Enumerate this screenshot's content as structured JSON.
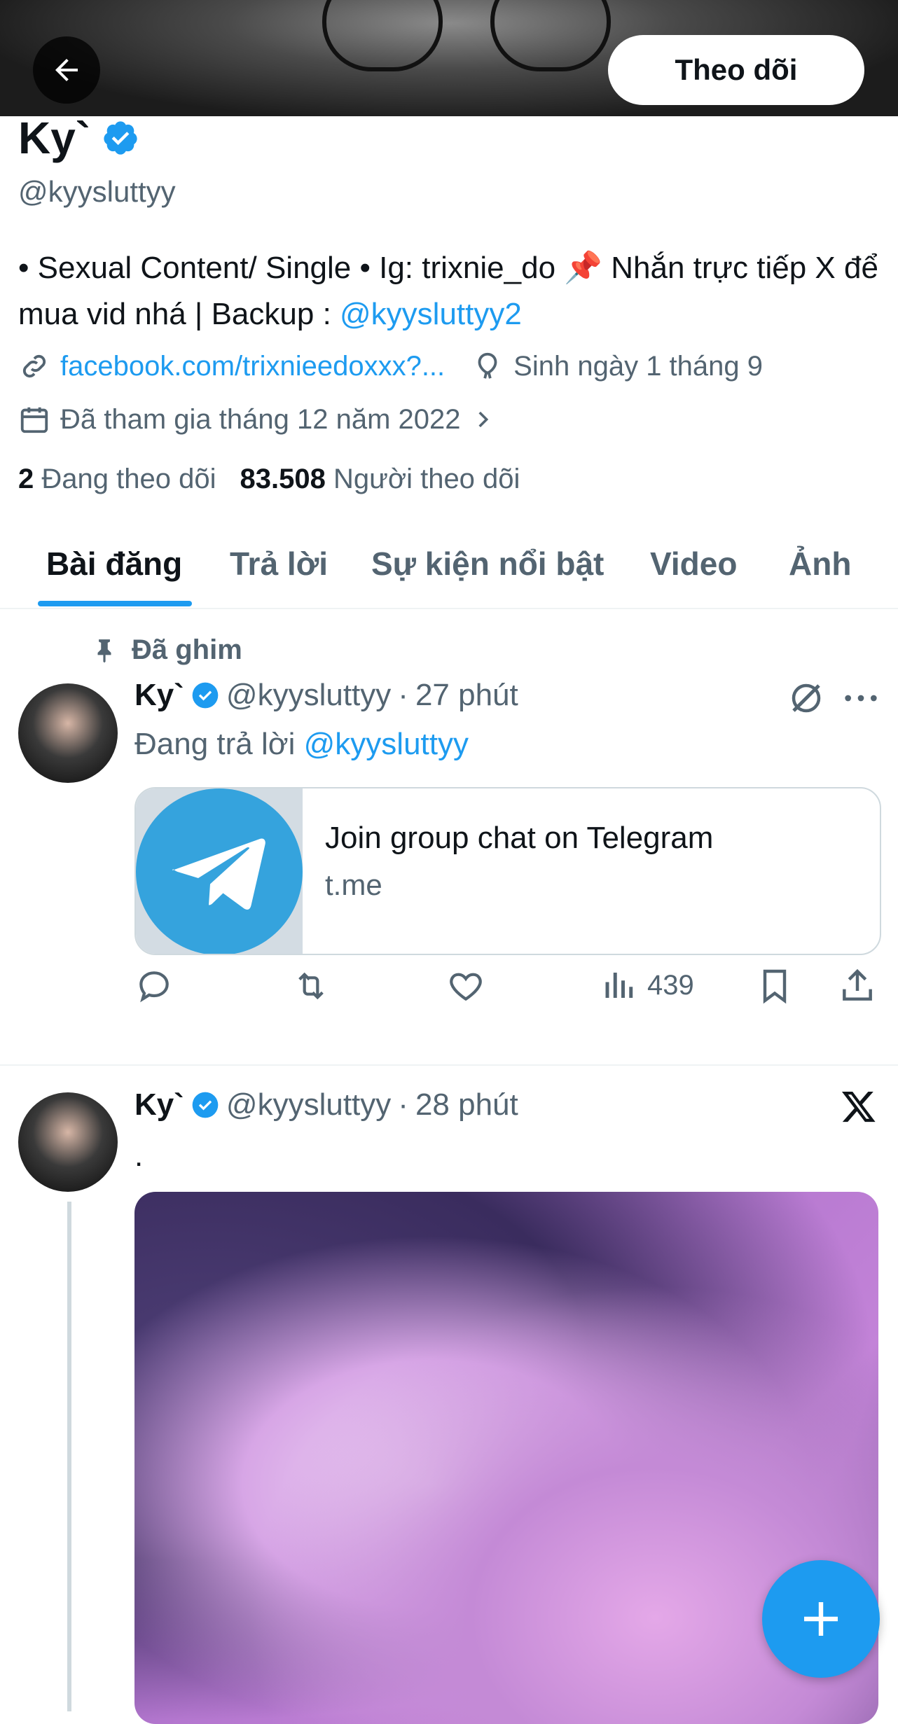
{
  "header": {
    "follow_label": "Theo dõi"
  },
  "profile": {
    "name": "Ky`",
    "handle": "@kyysluttyy",
    "bio_text": "• Sexual Content/ Single • Ig: trixnie_do 📌 Nhắn trực tiếp X để mua vid nhá | Backup : ",
    "bio_link": "@kyysluttyy2",
    "website": "facebook.com/trixnieedoxxx?...",
    "birthday": "Sinh ngày 1 tháng 9",
    "joined": "Đã tham gia tháng 12 năm 2022",
    "following_count": "2",
    "following_label": "Đang theo dõi",
    "followers_count": "83.508",
    "followers_label": "Người theo dõi"
  },
  "tabs": [
    {
      "label": "Bài đăng"
    },
    {
      "label": "Trả lời"
    },
    {
      "label": "Sự kiện nổi bật"
    },
    {
      "label": "Video"
    },
    {
      "label": "Ảnh"
    }
  ],
  "posts": [
    {
      "pinned_label": "Đã ghim",
      "name": "Ky`",
      "handle": "@kyysluttyy",
      "sep": "·",
      "time": "27 phút",
      "reply_prefix": "Đang trả lời ",
      "reply_handle": "@kyysluttyy",
      "card_title": "Join group chat on Telegram",
      "card_domain": "t.me",
      "views": "439"
    },
    {
      "name": "Ky`",
      "handle": "@kyysluttyy",
      "sep": "·",
      "time": "28 phút",
      "text": "."
    }
  ],
  "colors": {
    "accent": "#1d9bf0",
    "muted": "#536471",
    "text": "#0f1419"
  }
}
